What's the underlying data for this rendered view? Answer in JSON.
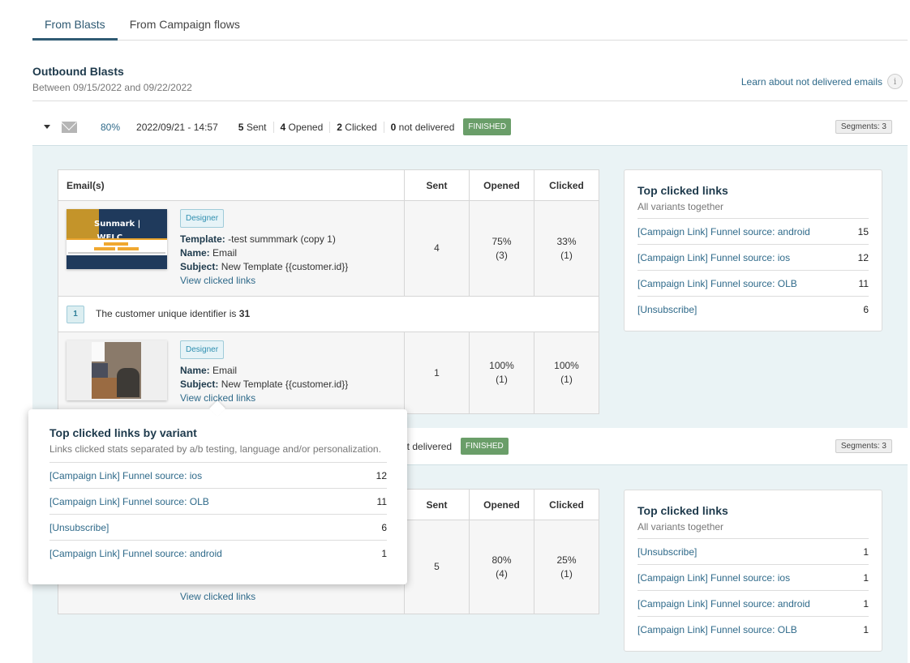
{
  "tabs": [
    {
      "label": "From Blasts",
      "active": true
    },
    {
      "label": "From Campaign flows",
      "active": false
    }
  ],
  "section": {
    "title": "Outbound Blasts",
    "subtitle": "Between 09/15/2022 and 09/22/2022",
    "learn_link": "Learn about not delivered emails",
    "info_icon": "i"
  },
  "colors": {
    "accent": "#2f5a73",
    "link": "#2f6a8a",
    "finished": "#6a9e69",
    "details_bg": "#eaf3f5"
  },
  "blasts": [
    {
      "expanded": true,
      "icon": "envelope-icon",
      "percent": "80%",
      "datetime": "2022/09/21 - 14:57",
      "sent_num": "5",
      "sent_label": "Sent",
      "opened_num": "4",
      "opened_label": "Opened",
      "clicked_num": "2",
      "clicked_label": "Clicked",
      "notdelivered_num": "0",
      "notdelivered_label": "not delivered",
      "status": "FINISHED",
      "segments": "Segments: 3",
      "table": {
        "headers": [
          "Email(s)",
          "Sent",
          "Opened",
          "Clicked"
        ],
        "rows": [
          {
            "tag": "Designer",
            "template_label": "Template:",
            "template": "-test summmark (copy 1)",
            "name_label": "Name:",
            "name": "Email",
            "subject_label": "Subject:",
            "subject": "New Template {{customer.id}}",
            "view_link": "View clicked links",
            "sent": "4",
            "opened_pct": "75%",
            "opened_count": "(3)",
            "clicked_pct": "33%",
            "clicked_count": "(1)"
          },
          {
            "tag": "Designer",
            "name_label": "Name:",
            "name": "Email",
            "subject_label": "Subject:",
            "subject": "New Template {{customer.id}}",
            "view_link": "View clicked links",
            "sent": "1",
            "opened_pct": "100%",
            "opened_count": "(1)",
            "clicked_pct": "100%",
            "clicked_count": "(1)"
          }
        ],
        "segment_row": {
          "num": "1",
          "text": "The customer unique identifier is ",
          "value": "31"
        }
      },
      "top_links": {
        "title": "Top clicked links",
        "subtitle": "All variants together",
        "items": [
          {
            "label": "[Campaign Link] Funnel source: android",
            "count": "15"
          },
          {
            "label": "[Campaign Link] Funnel source: ios",
            "count": "12"
          },
          {
            "label": "[Campaign Link] Funnel source: OLB",
            "count": "11"
          },
          {
            "label": "[Unsubscribe]",
            "count": "6"
          }
        ]
      }
    },
    {
      "expanded": true,
      "notdelivered_label_partial": "ot delivered",
      "status": "FINISHED",
      "segments": "Segments: 3",
      "table": {
        "headers": [
          "Sent",
          "Opened",
          "Clicked"
        ],
        "row": {
          "view_link": "View clicked links",
          "sent": "5",
          "opened_pct": "80%",
          "opened_count": "(4)",
          "clicked_pct": "25%",
          "clicked_count": "(1)"
        }
      },
      "top_links": {
        "title": "Top clicked links",
        "subtitle": "All variants together",
        "items": [
          {
            "label": "[Unsubscribe]",
            "count": "1"
          },
          {
            "label": "[Campaign Link] Funnel source: ios",
            "count": "1"
          },
          {
            "label": "[Campaign Link] Funnel source: android",
            "count": "1"
          },
          {
            "label": "[Campaign Link] Funnel source: OLB",
            "count": "1"
          }
        ]
      }
    }
  ],
  "popover": {
    "title": "Top clicked links by variant",
    "subtitle": "Links clicked stats separated by a/b testing, language and/or personalization.",
    "items": [
      {
        "label": "[Campaign Link] Funnel source: ios",
        "count": "12"
      },
      {
        "label": "[Campaign Link] Funnel source: OLB",
        "count": "11"
      },
      {
        "label": "[Unsubscribe]",
        "count": "6"
      },
      {
        "label": "[Campaign Link] Funnel source: android",
        "count": "1"
      }
    ]
  }
}
